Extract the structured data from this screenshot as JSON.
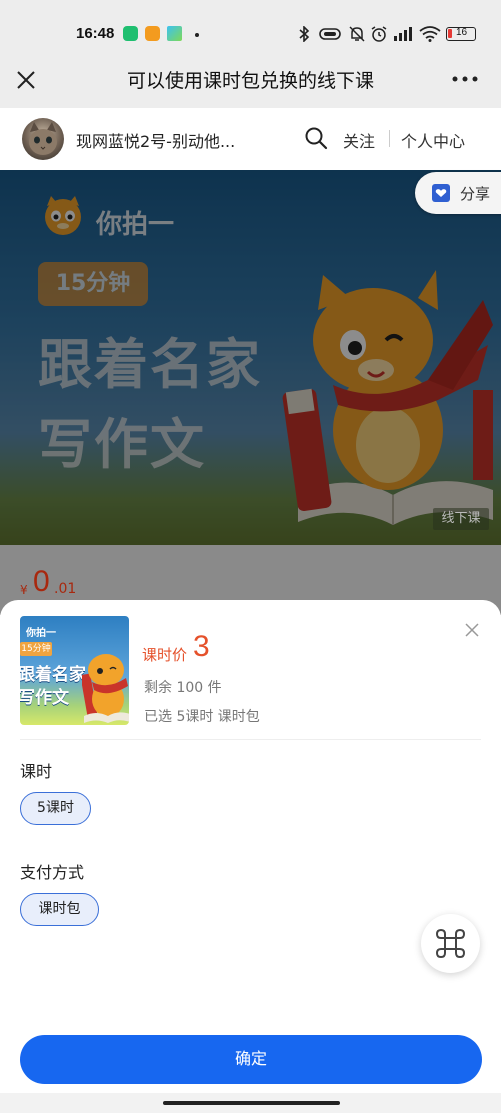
{
  "status_bar": {
    "time": "16:48",
    "battery_level": "16",
    "battery_color": "#e53935"
  },
  "title_bar": {
    "title": "可以使用课时包兑换的线下课",
    "close_icon": "close-icon",
    "more_icon": "more-dots-icon"
  },
  "shop": {
    "name": "现网蓝悦2号-别动他...",
    "follow_label": "关注",
    "center_label": "个人中心",
    "search_icon": "search-icon"
  },
  "banner": {
    "logo_text": "你拍一",
    "badge": "15分钟",
    "title_line1": "跟着名家",
    "title_line2": "写作文",
    "tag": "线下课",
    "share_label": "分享"
  },
  "price_strip": {
    "currency": "¥",
    "integer": "0",
    "decimal": ".01"
  },
  "sheet": {
    "thumb": {
      "logo_text": "你拍一",
      "badge": "15分钟",
      "title_line1": "跟着名家",
      "title_line2": "写作文"
    },
    "price_label": "课时价",
    "price_value": "3",
    "stock_text": "剩余 100 件",
    "selected_text": "已选 5课时 课时包",
    "section_hours": {
      "label": "课时",
      "option": "5课时"
    },
    "section_payment": {
      "label": "支付方式",
      "option": "课时包"
    },
    "confirm_label": "确定",
    "accent_color": "#1767f0",
    "price_color": "#e5512b"
  }
}
